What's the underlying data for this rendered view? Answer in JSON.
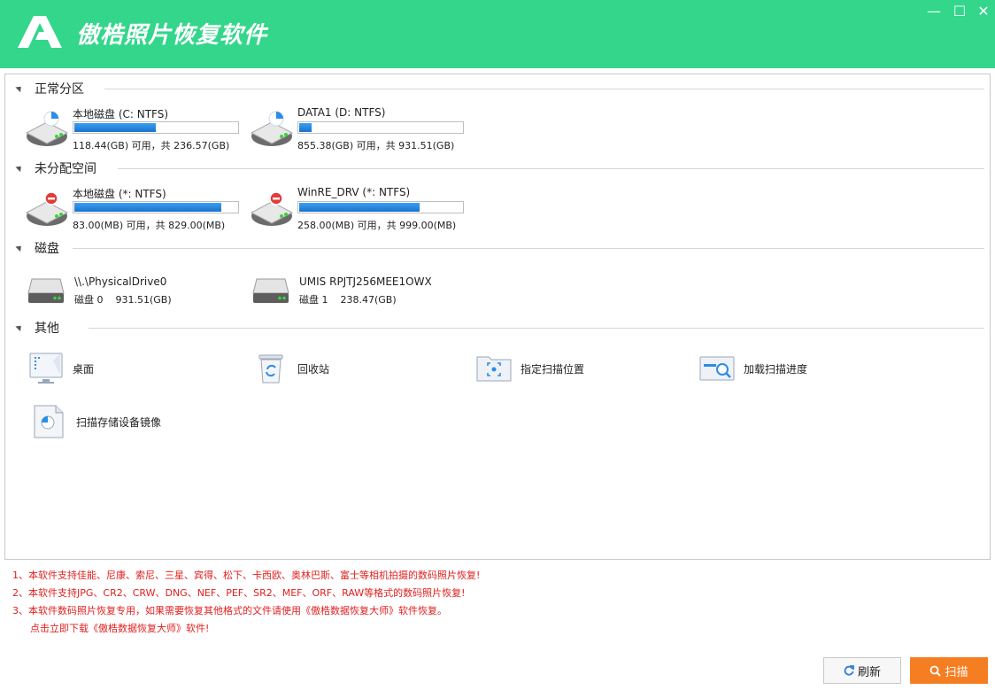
{
  "app": {
    "title": "傲梏照片恢复软件"
  },
  "window": {
    "minimize": "—",
    "maximize": "☐",
    "close": "✕"
  },
  "sections": {
    "normal": "正常分区",
    "unallocated": "未分配空间",
    "disks": "磁盘",
    "other": "其他"
  },
  "normal_partitions": [
    {
      "name": "本地磁盘 (C: NTFS)",
      "info": "118.44(GB) 可用，共 236.57(GB)",
      "used_fraction": 0.5
    },
    {
      "name": "DATA1 (D: NTFS)",
      "info": "855.38(GB) 可用，共 931.51(GB)",
      "used_fraction": 0.08
    }
  ],
  "unallocated_partitions": [
    {
      "name": "本地磁盘 (*: NTFS)",
      "info": "83.00(MB) 可用，共 829.00(MB)",
      "used_fraction": 0.9
    },
    {
      "name": "WinRE_DRV (*: NTFS)",
      "info": "258.00(MB) 可用，共 999.00(MB)",
      "used_fraction": 0.74
    }
  ],
  "disks": [
    {
      "name": "\\\\.\\PhysicalDrive0",
      "label": "磁盘 0",
      "size": "931.51(GB)"
    },
    {
      "name": "UMIS RPJTJ256MEE1OWX",
      "label": "磁盘 1",
      "size": "238.47(GB)"
    }
  ],
  "others": {
    "desktop": "桌面",
    "recycle": "回收站",
    "location": "指定扫描位置",
    "progress": "加载扫描进度",
    "image": "扫描存储设备镜像"
  },
  "notes": [
    "1、本软件支持佳能、尼康、索尼、三星、宾得、松下、卡西欧、奥林巴斯、富士等相机拍摄的数码照片恢复!",
    "2、本软件支持JPG、CR2、CRW、DNG、NEF、PEF、SR2、MEF、ORF、RAW等格式的数码照片恢复!",
    "3、本软件数码照片恢复专用，如果需要恢复其他格式的文件请使用《傲梏数据恢复大师》软件恢复。",
    "点击立即下载《傲梏数据恢复大师》软件!"
  ],
  "buttons": {
    "refresh": "刷新",
    "scan": "扫描"
  },
  "colors": {
    "titlebar": "#33d68b",
    "scan": "#f57e22",
    "note": "#e02020",
    "bar": "#1a72cf"
  }
}
